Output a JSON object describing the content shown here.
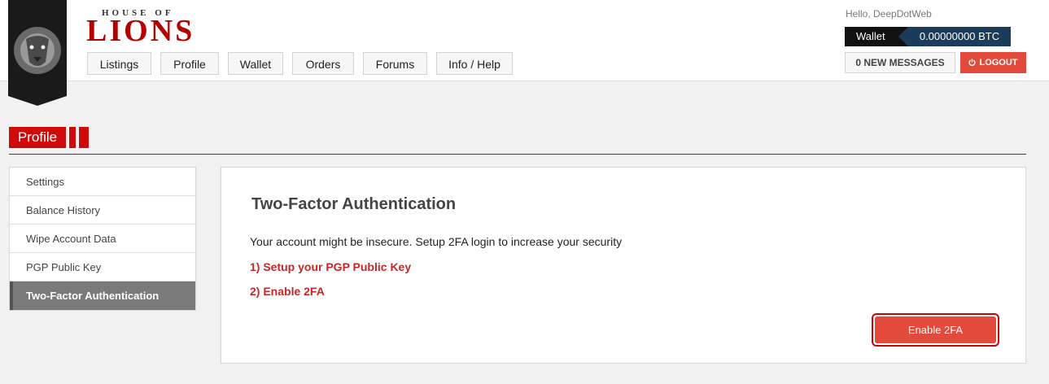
{
  "brand": {
    "top": "HOUSE OF",
    "main": "LIONS"
  },
  "nav": [
    "Listings",
    "Profile",
    "Wallet",
    "Orders",
    "Forums",
    "Info / Help"
  ],
  "user": {
    "greeting": "Hello, DeepDotWeb",
    "wallet_label": "Wallet",
    "wallet_balance": "0.00000000 BTC",
    "messages": "0 NEW MESSAGES",
    "logout": "LOGOUT"
  },
  "page": {
    "title": "Profile"
  },
  "sidebar": {
    "items": [
      {
        "label": "Settings"
      },
      {
        "label": "Balance History"
      },
      {
        "label": "Wipe Account Data"
      },
      {
        "label": "PGP Public Key"
      },
      {
        "label": "Two-Factor Authentication",
        "active": true
      }
    ]
  },
  "panel": {
    "title": "Two-Factor Authentication",
    "description": "Your account might be insecure. Setup 2FA login to increase your security",
    "steps": [
      "1) Setup your PGP Public Key",
      "2) Enable 2FA"
    ],
    "button": "Enable 2FA"
  },
  "colors": {
    "accent": "#cf0a0a",
    "button": "#e24b3b",
    "wallet": "#1b3c5a",
    "active_item": "#7a7a7a"
  }
}
